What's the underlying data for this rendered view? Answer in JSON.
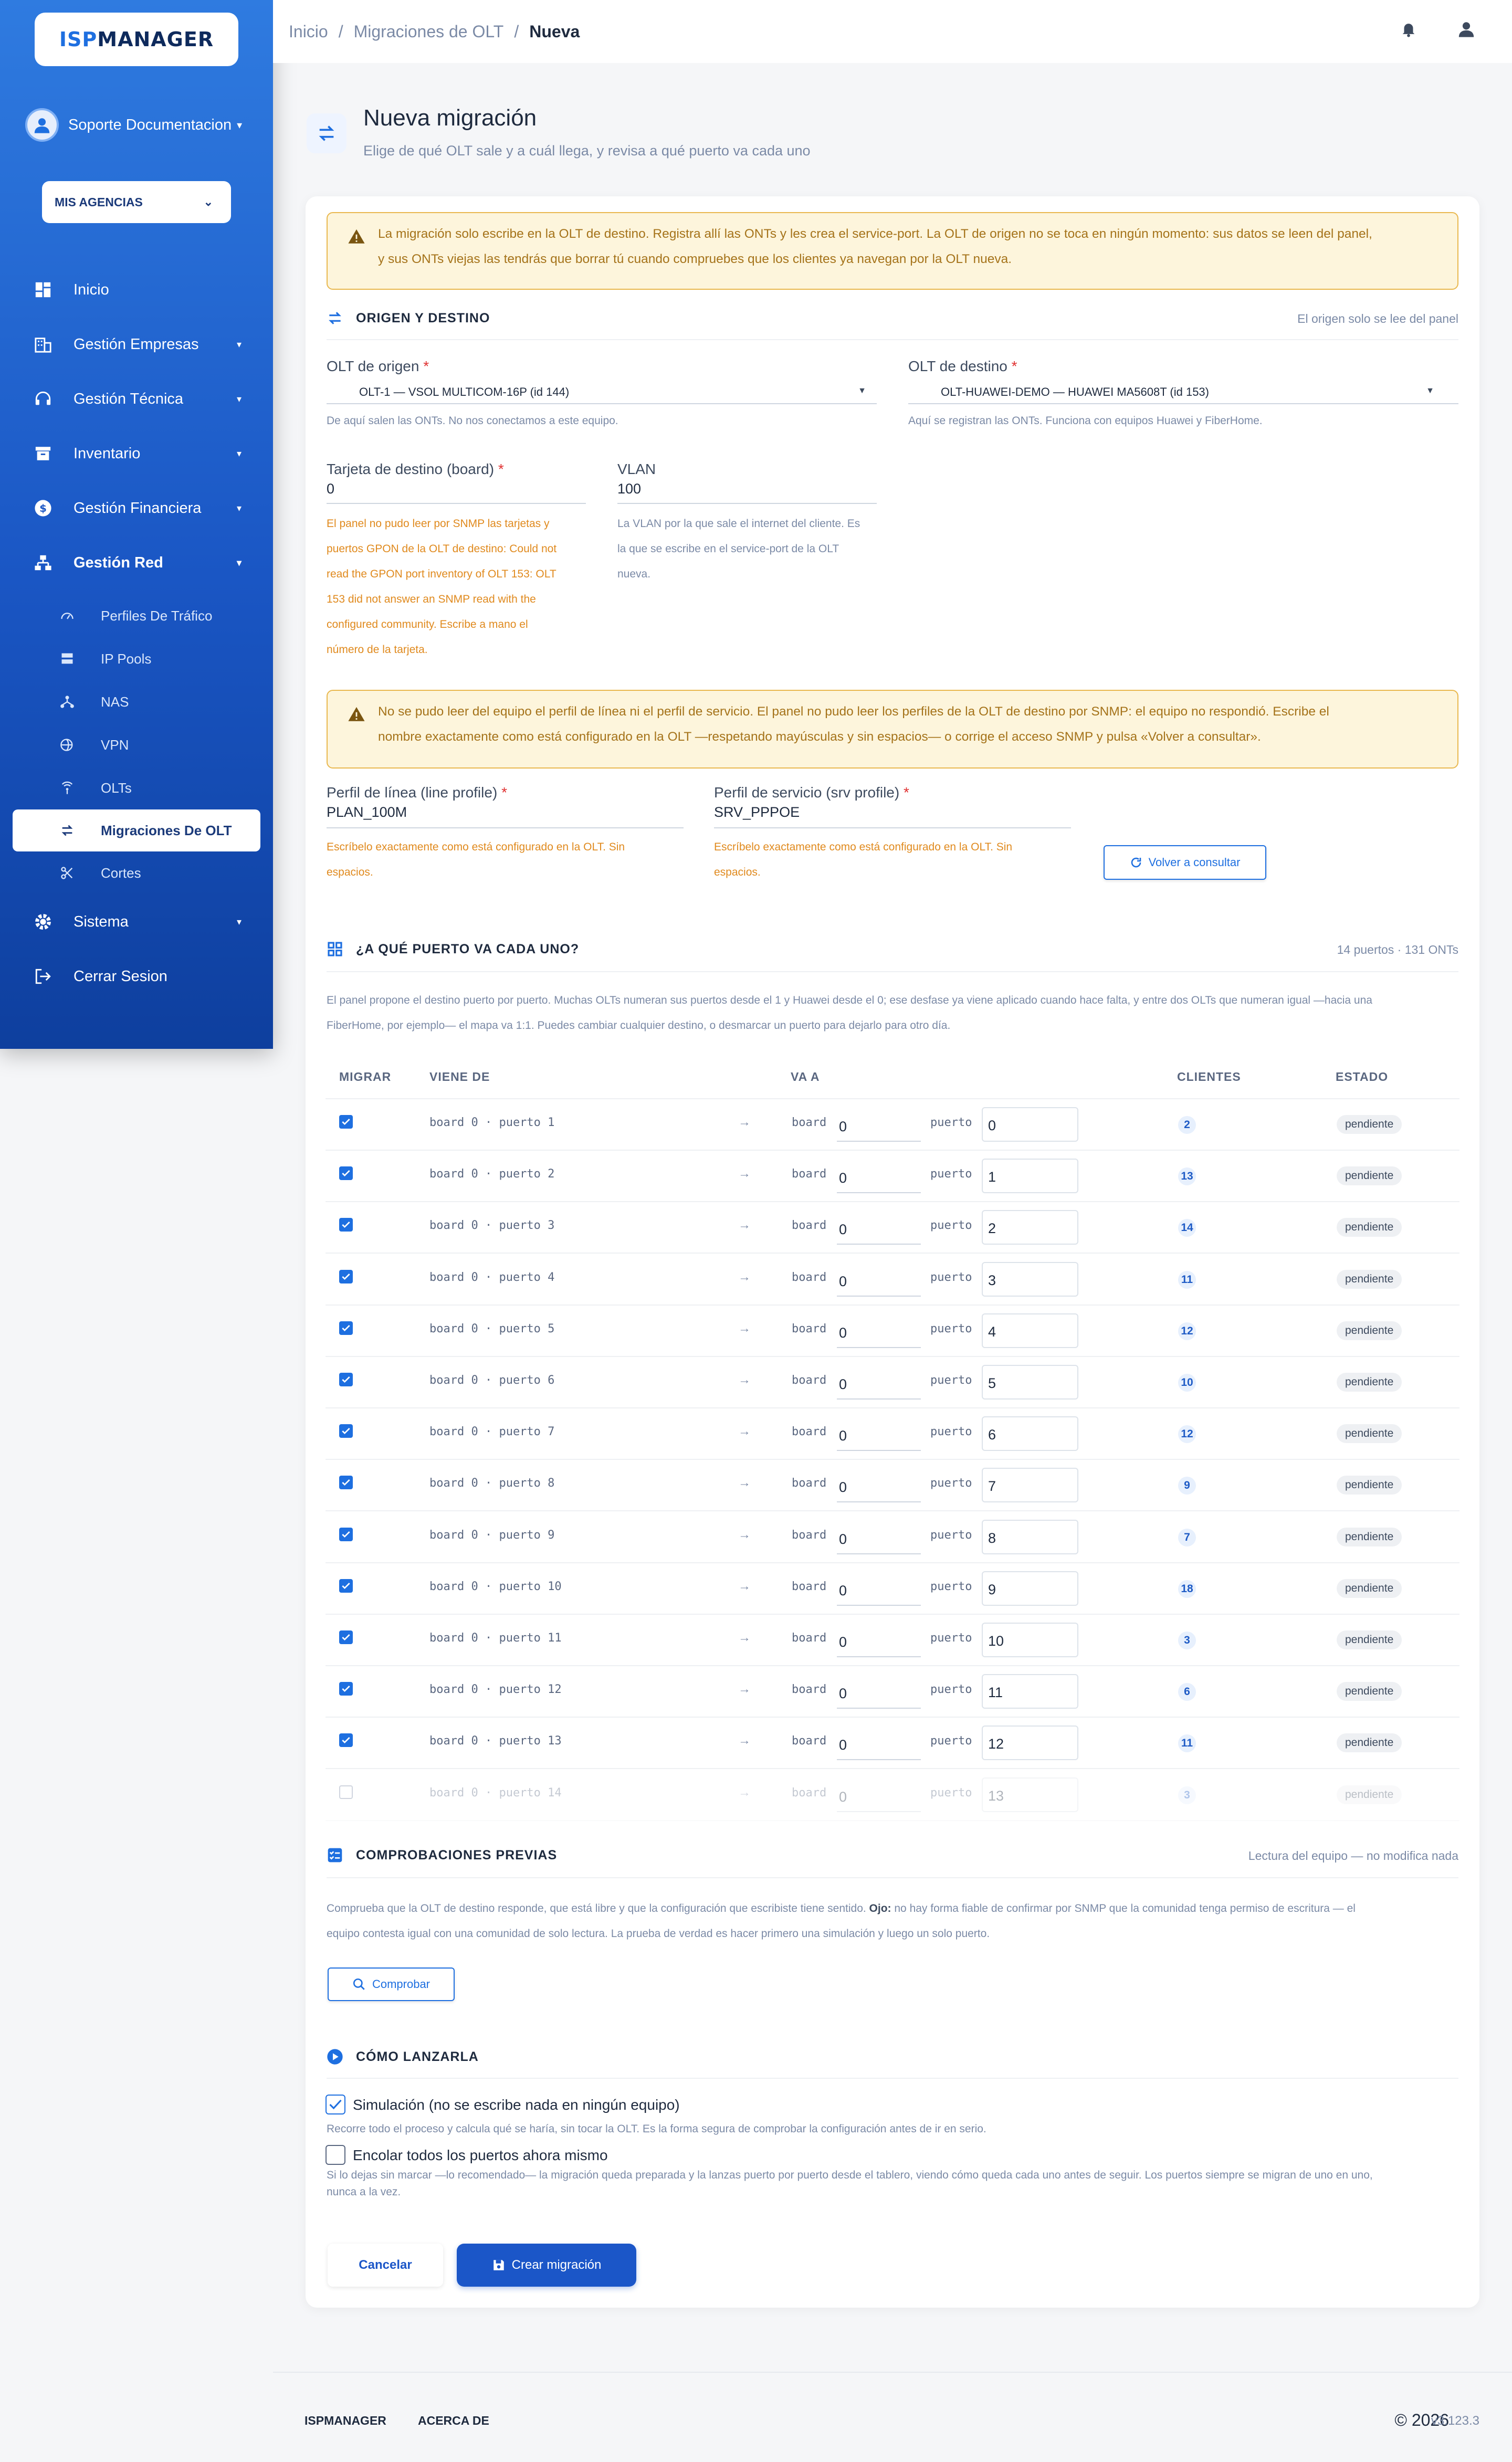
{
  "brand": {
    "part1": "ISP",
    "part2": "MANAGER"
  },
  "user": {
    "name": "Soporte Documentacion"
  },
  "agency": {
    "label": "MIS AGENCIAS"
  },
  "nav": {
    "inicio": "Inicio",
    "empresas": "Gestión Empresas",
    "tecnica": "Gestión Técnica",
    "inventario": "Inventario",
    "financiera": "Gestión Financiera",
    "red": "Gestión Red",
    "sub_perfiles": "Perfiles De Tráfico",
    "sub_ippools": "IP Pools",
    "sub_nas": "NAS",
    "sub_vpn": "VPN",
    "sub_olts": "OLTs",
    "sub_migraciones": "Migraciones De OLT",
    "sub_cortes": "Cortes",
    "sistema": "Sistema",
    "cerrar": "Cerrar Sesion"
  },
  "breadcrumb": {
    "home": "Inicio",
    "section": "Migraciones de OLT",
    "current": "Nueva"
  },
  "header": {
    "title": "Nueva migración",
    "subtitle": "Elige de qué OLT sale y a cuál llega, y revisa a qué puerto va cada uno"
  },
  "alert1": {
    "line1": "La migración solo escribe en la OLT de destino. Registra allí las ONTs y les crea el service-port. La OLT de origen no se toca en ningún momento: sus datos se leen del panel,",
    "line2": "y sus ONTs viejas las tendrás que borrar tú cuando compruebes que los clientes ya navegan por la OLT nueva."
  },
  "origin": {
    "section_title": "ORIGEN Y DESTINO",
    "section_note": "El origen solo se lee del panel",
    "src_label": "OLT de origen",
    "src_value": "OLT-1 — VSOL MULTICOM-16P (id 144)",
    "src_help": "De aquí salen las ONTs. No nos conectamos a este equipo.",
    "dst_label": "OLT de destino",
    "dst_value": "OLT-HUAWEI-DEMO — HUAWEI MA5608T (id 153)",
    "dst_help": "Aquí se registran las ONTs. Funciona con equipos Huawei y FiberHome.",
    "board_label": "Tarjeta de destino (board)",
    "board_value": "0",
    "board_err": [
      "El panel no pudo leer por SNMP las tarjetas y",
      "puertos GPON de la OLT de destino: Could not",
      "read the GPON port inventory of OLT 153: OLT",
      "153 did not answer an SNMP read with the",
      "configured community. Escribe a mano el",
      "número de la tarjeta."
    ],
    "vlan_label": "VLAN",
    "vlan_value": "100",
    "vlan_help": [
      "La VLAN por la que sale el internet del cliente. Es",
      "la que se escribe en el service-port de la OLT",
      "nueva."
    ]
  },
  "alert2": {
    "line1": "No se pudo leer del equipo el perfil de línea ni el perfil de servicio. El panel no pudo leer los perfiles de la OLT de destino por SNMP: el equipo no respondió. Escribe el",
    "line2": "nombre exactamente como está configurado en la OLT —respetando mayúsculas y sin espacios— o corrige el acceso SNMP y pulsa «Volver a consultar»."
  },
  "profiles": {
    "line_label": "Perfil de línea (line profile)",
    "line_value": "PLAN_100M",
    "srv_label": "Perfil de servicio (srv profile)",
    "srv_value": "SRV_PPPOE",
    "err1": "Escríbelo exactamente como está configurado en la OLT. Sin",
    "err2": "espacios.",
    "requery": "Volver a consultar"
  },
  "ports": {
    "section_title": "¿A QUÉ PUERTO VA CADA UNO?",
    "section_note": "14 puertos · 131 ONTs",
    "desc1": "El panel propone el destino puerto por puerto. Muchas OLTs numeran sus puertos desde el 1 y Huawei desde el 0; ese desfase ya viene aplicado cuando hace falta, y entre dos OLTs que numeran igual —hacia una",
    "desc2": "FiberHome, por ejemplo— el mapa va 1:1. Puedes cambiar cualquier destino, o desmarcar un puerto para dejarlo para otro día.",
    "headers": {
      "migrar": "MIGRAR",
      "viene": "VIENE DE",
      "va": "VA A",
      "clientes": "CLIENTES",
      "estado": "ESTADO"
    },
    "board_word": "board",
    "port_word": "puerto",
    "rows": [
      {
        "from": "board 0 · puerto 1",
        "board": "0",
        "port": "0",
        "clients": "2",
        "status": "pendiente",
        "checked": true
      },
      {
        "from": "board 0 · puerto 2",
        "board": "0",
        "port": "1",
        "clients": "13",
        "status": "pendiente",
        "checked": true
      },
      {
        "from": "board 0 · puerto 3",
        "board": "0",
        "port": "2",
        "clients": "14",
        "status": "pendiente",
        "checked": true
      },
      {
        "from": "board 0 · puerto 4",
        "board": "0",
        "port": "3",
        "clients": "11",
        "status": "pendiente",
        "checked": true
      },
      {
        "from": "board 0 · puerto 5",
        "board": "0",
        "port": "4",
        "clients": "12",
        "status": "pendiente",
        "checked": true
      },
      {
        "from": "board 0 · puerto 6",
        "board": "0",
        "port": "5",
        "clients": "10",
        "status": "pendiente",
        "checked": true
      },
      {
        "from": "board 0 · puerto 7",
        "board": "0",
        "port": "6",
        "clients": "12",
        "status": "pendiente",
        "checked": true
      },
      {
        "from": "board 0 · puerto 8",
        "board": "0",
        "port": "7",
        "clients": "9",
        "status": "pendiente",
        "checked": true
      },
      {
        "from": "board 0 · puerto 9",
        "board": "0",
        "port": "8",
        "clients": "7",
        "status": "pendiente",
        "checked": true
      },
      {
        "from": "board 0 · puerto 10",
        "board": "0",
        "port": "9",
        "clients": "18",
        "status": "pendiente",
        "checked": true
      },
      {
        "from": "board 0 · puerto 11",
        "board": "0",
        "port": "10",
        "clients": "3",
        "status": "pendiente",
        "checked": true
      },
      {
        "from": "board 0 · puerto 12",
        "board": "0",
        "port": "11",
        "clients": "6",
        "status": "pendiente",
        "checked": true
      },
      {
        "from": "board 0 · puerto 13",
        "board": "0",
        "port": "12",
        "clients": "11",
        "status": "pendiente",
        "checked": true
      },
      {
        "from": "board 0 · puerto 14",
        "board": "0",
        "port": "13",
        "clients": "3",
        "status": "pendiente",
        "checked": false
      }
    ]
  },
  "checks": {
    "section_title": "COMPROBACIONES PREVIAS",
    "section_note": "Lectura del equipo — no modifica nada",
    "desc1a": "Comprueba que la OLT de destino responde, que está libre y que la configuración que escribiste tiene sentido. ",
    "desc1b": "Ojo:",
    "desc1c": " no hay forma fiable de confirmar por SNMP que la comunidad tenga permiso de escritura — el",
    "desc2": "equipo contesta igual con una comunidad de solo lectura. La prueba de verdad es hacer primero una simulación y luego un solo puerto.",
    "button": "Comprobar"
  },
  "launch": {
    "section_title": "CÓMO LANZARLA",
    "sim_label": "Simulación (no se escribe nada en ningún equipo)",
    "sim_help": "Recorre todo el proceso y calcula qué se haría, sin tocar la OLT. Es la forma segura de comprobar la configuración antes de ir en serio.",
    "queue_label": "Encolar todos los puertos ahora mismo",
    "queue_help1": "Si lo dejas sin marcar —lo recomendado— la migración queda preparada y la lanzas puerto por puerto desde el tablero, viendo cómo queda cada uno antes de seguir. Los puertos siempre se migran de uno en uno,",
    "queue_help2": "nunca a la vez.",
    "cancel": "Cancelar",
    "create": "Crear migración"
  },
  "footer": {
    "link1": "ISPMANAGER",
    "link2": "ACERCA DE",
    "copy": "© 2026",
    "version": "v3.123.3"
  },
  "colors": {
    "primary": "#1e6fe0",
    "warning_bg": "#fdf5dc",
    "warning_text": "#a5731a",
    "error": "#e08a1e"
  }
}
